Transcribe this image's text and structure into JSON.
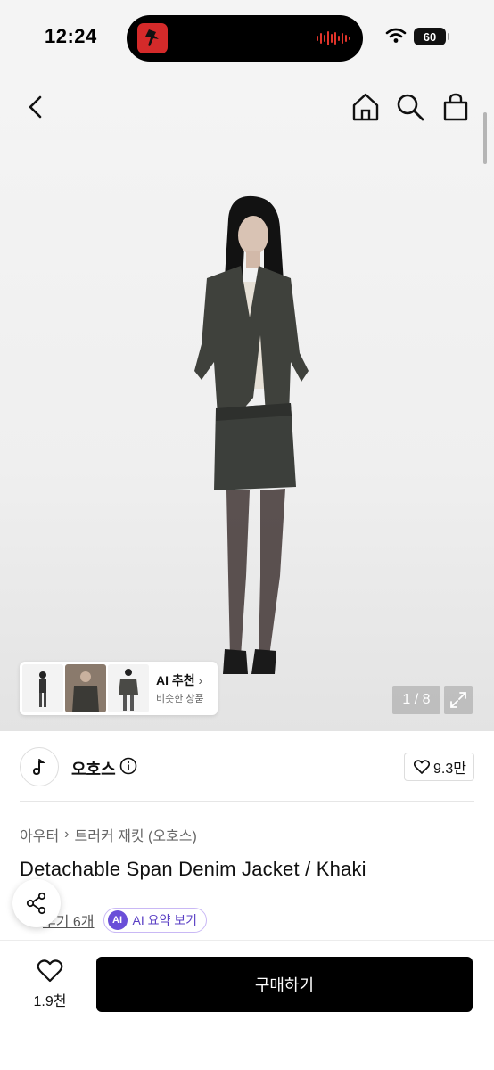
{
  "status_bar": {
    "time": "12:24",
    "battery": "60",
    "icons": [
      "wifi-icon",
      "battery-icon"
    ]
  },
  "nav": {
    "icons": [
      "back-icon",
      "home-icon",
      "search-icon",
      "shopping-bag-icon"
    ]
  },
  "gallery": {
    "counter": "1 / 8",
    "ai_recommend": {
      "title": "AI 추천",
      "subtitle": "비슷한 상품"
    }
  },
  "brand": {
    "name": "오호스",
    "likes": "9.3만"
  },
  "product": {
    "breadcrumb": [
      "아우터",
      "트러커 재킷 (오호스)"
    ],
    "title": "Detachable Span Denim Jacket / Khaki",
    "reviews": "후기 6개",
    "ai_badge": "AI",
    "ai_summary": "AI 요약 보기"
  },
  "bottom_bar": {
    "wish_count": "1.9천",
    "buy_label": "구매하기"
  },
  "colors": {
    "accent_ai": "#6a4fd8",
    "buy_button": "#000000",
    "star": "#f5b400"
  }
}
